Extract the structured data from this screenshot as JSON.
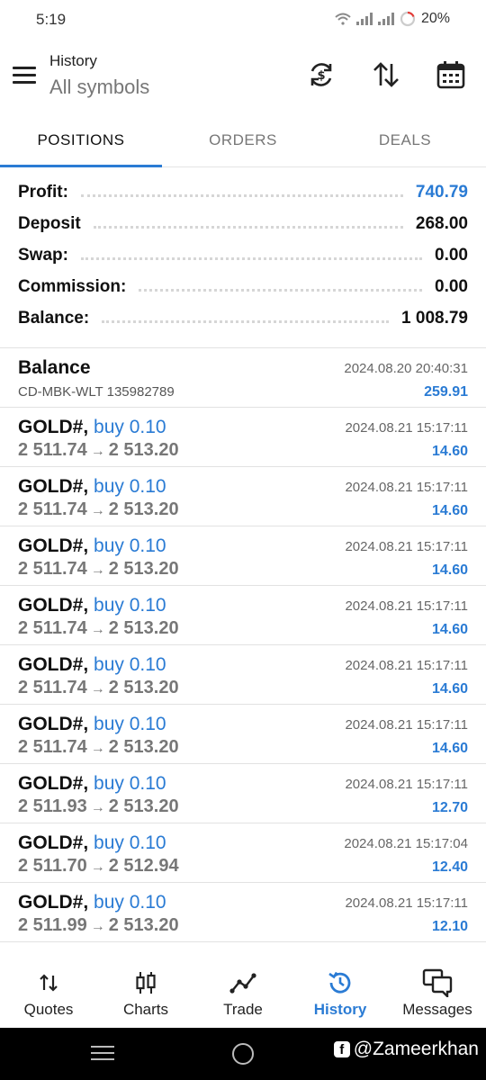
{
  "status": {
    "time": "5:19",
    "battery": "20%"
  },
  "header": {
    "subtitle": "History",
    "title": "All symbols"
  },
  "tabs": [
    {
      "label": "POSITIONS",
      "active": true
    },
    {
      "label": "ORDERS",
      "active": false
    },
    {
      "label": "DEALS",
      "active": false
    }
  ],
  "summary": {
    "profit_label": "Profit:",
    "profit": "740.79",
    "deposit_label": "Deposit",
    "deposit": "268.00",
    "swap_label": "Swap:",
    "swap": "0.00",
    "commission_label": "Commission:",
    "commission": "0.00",
    "balance_label": "Balance:",
    "balance": "1 008.79"
  },
  "balance_entry": {
    "title": "Balance",
    "comment": "CD-MBK-WLT 135982789",
    "date": "2024.08.20 20:40:31",
    "amount": "259.91"
  },
  "positions": [
    {
      "symbol": "GOLD#,",
      "side": "buy 0.10",
      "open": "2 511.74",
      "close": "2 513.20",
      "date": "2024.08.21 15:17:11",
      "profit": "14.60"
    },
    {
      "symbol": "GOLD#,",
      "side": "buy 0.10",
      "open": "2 511.74",
      "close": "2 513.20",
      "date": "2024.08.21 15:17:11",
      "profit": "14.60"
    },
    {
      "symbol": "GOLD#,",
      "side": "buy 0.10",
      "open": "2 511.74",
      "close": "2 513.20",
      "date": "2024.08.21 15:17:11",
      "profit": "14.60"
    },
    {
      "symbol": "GOLD#,",
      "side": "buy 0.10",
      "open": "2 511.74",
      "close": "2 513.20",
      "date": "2024.08.21 15:17:11",
      "profit": "14.60"
    },
    {
      "symbol": "GOLD#,",
      "side": "buy 0.10",
      "open": "2 511.74",
      "close": "2 513.20",
      "date": "2024.08.21 15:17:11",
      "profit": "14.60"
    },
    {
      "symbol": "GOLD#,",
      "side": "buy 0.10",
      "open": "2 511.74",
      "close": "2 513.20",
      "date": "2024.08.21 15:17:11",
      "profit": "14.60"
    },
    {
      "symbol": "GOLD#,",
      "side": "buy 0.10",
      "open": "2 511.93",
      "close": "2 513.20",
      "date": "2024.08.21 15:17:11",
      "profit": "12.70"
    },
    {
      "symbol": "GOLD#,",
      "side": "buy 0.10",
      "open": "2 511.70",
      "close": "2 512.94",
      "date": "2024.08.21 15:17:04",
      "profit": "12.40"
    },
    {
      "symbol": "GOLD#,",
      "side": "buy 0.10",
      "open": "2 511.99",
      "close": "2 513.20",
      "date": "2024.08.21 15:17:11",
      "profit": "12.10"
    }
  ],
  "arrow_glyph": "→",
  "bottom_nav": [
    {
      "label": "Quotes",
      "icon": "quotes-icon",
      "active": false
    },
    {
      "label": "Charts",
      "icon": "charts-icon",
      "active": false
    },
    {
      "label": "Trade",
      "icon": "trade-icon",
      "active": false
    },
    {
      "label": "History",
      "icon": "history-icon",
      "active": true
    },
    {
      "label": "Messages",
      "icon": "messages-icon",
      "active": false
    }
  ],
  "watermark": {
    "text": "@Zameerkhan"
  },
  "colors": {
    "accent": "#2a7bd4",
    "text": "#111111",
    "muted": "#777777"
  }
}
